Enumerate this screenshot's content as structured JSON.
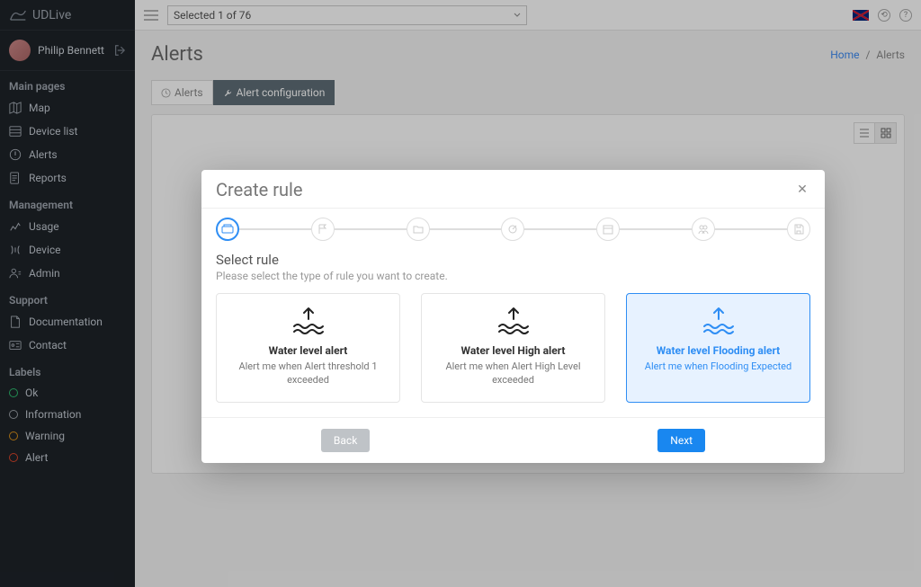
{
  "brand": "UDLive",
  "user": {
    "name": "Philip Bennett"
  },
  "sidebar": {
    "sections": {
      "main": {
        "label": "Main pages",
        "items": [
          {
            "label": "Map"
          },
          {
            "label": "Device list"
          },
          {
            "label": "Alerts"
          },
          {
            "label": "Reports"
          }
        ]
      },
      "mgmt": {
        "label": "Management",
        "items": [
          {
            "label": "Usage"
          },
          {
            "label": "Device"
          },
          {
            "label": "Admin"
          }
        ]
      },
      "support": {
        "label": "Support",
        "items": [
          {
            "label": "Documentation"
          },
          {
            "label": "Contact"
          }
        ]
      },
      "labels": {
        "label": "Labels",
        "items": [
          {
            "label": "Ok",
            "color": "#2dbd6e"
          },
          {
            "label": "Information",
            "color": "#9aa0a6"
          },
          {
            "label": "Warning",
            "color": "#d9901a"
          },
          {
            "label": "Alert",
            "color": "#d9452b"
          }
        ]
      }
    }
  },
  "topbar": {
    "dropdown": "Selected 1 of 76"
  },
  "page": {
    "title": "Alerts"
  },
  "breadcrumb": {
    "home": "Home",
    "current": "Alerts"
  },
  "tabs": {
    "alerts": "Alerts",
    "config": "Alert configuration"
  },
  "modal": {
    "title": "Create rule",
    "step_title": "Select rule",
    "step_sub": "Please select the type of rule you want to create.",
    "cards": [
      {
        "title": "Water level alert",
        "desc": "Alert me when Alert threshold 1 exceeded"
      },
      {
        "title": "Water level High alert",
        "desc": "Alert me when Alert High Level exceeded"
      },
      {
        "title": "Water level Flooding alert",
        "desc": "Alert me when Flooding Expected"
      }
    ],
    "back": "Back",
    "next": "Next"
  }
}
